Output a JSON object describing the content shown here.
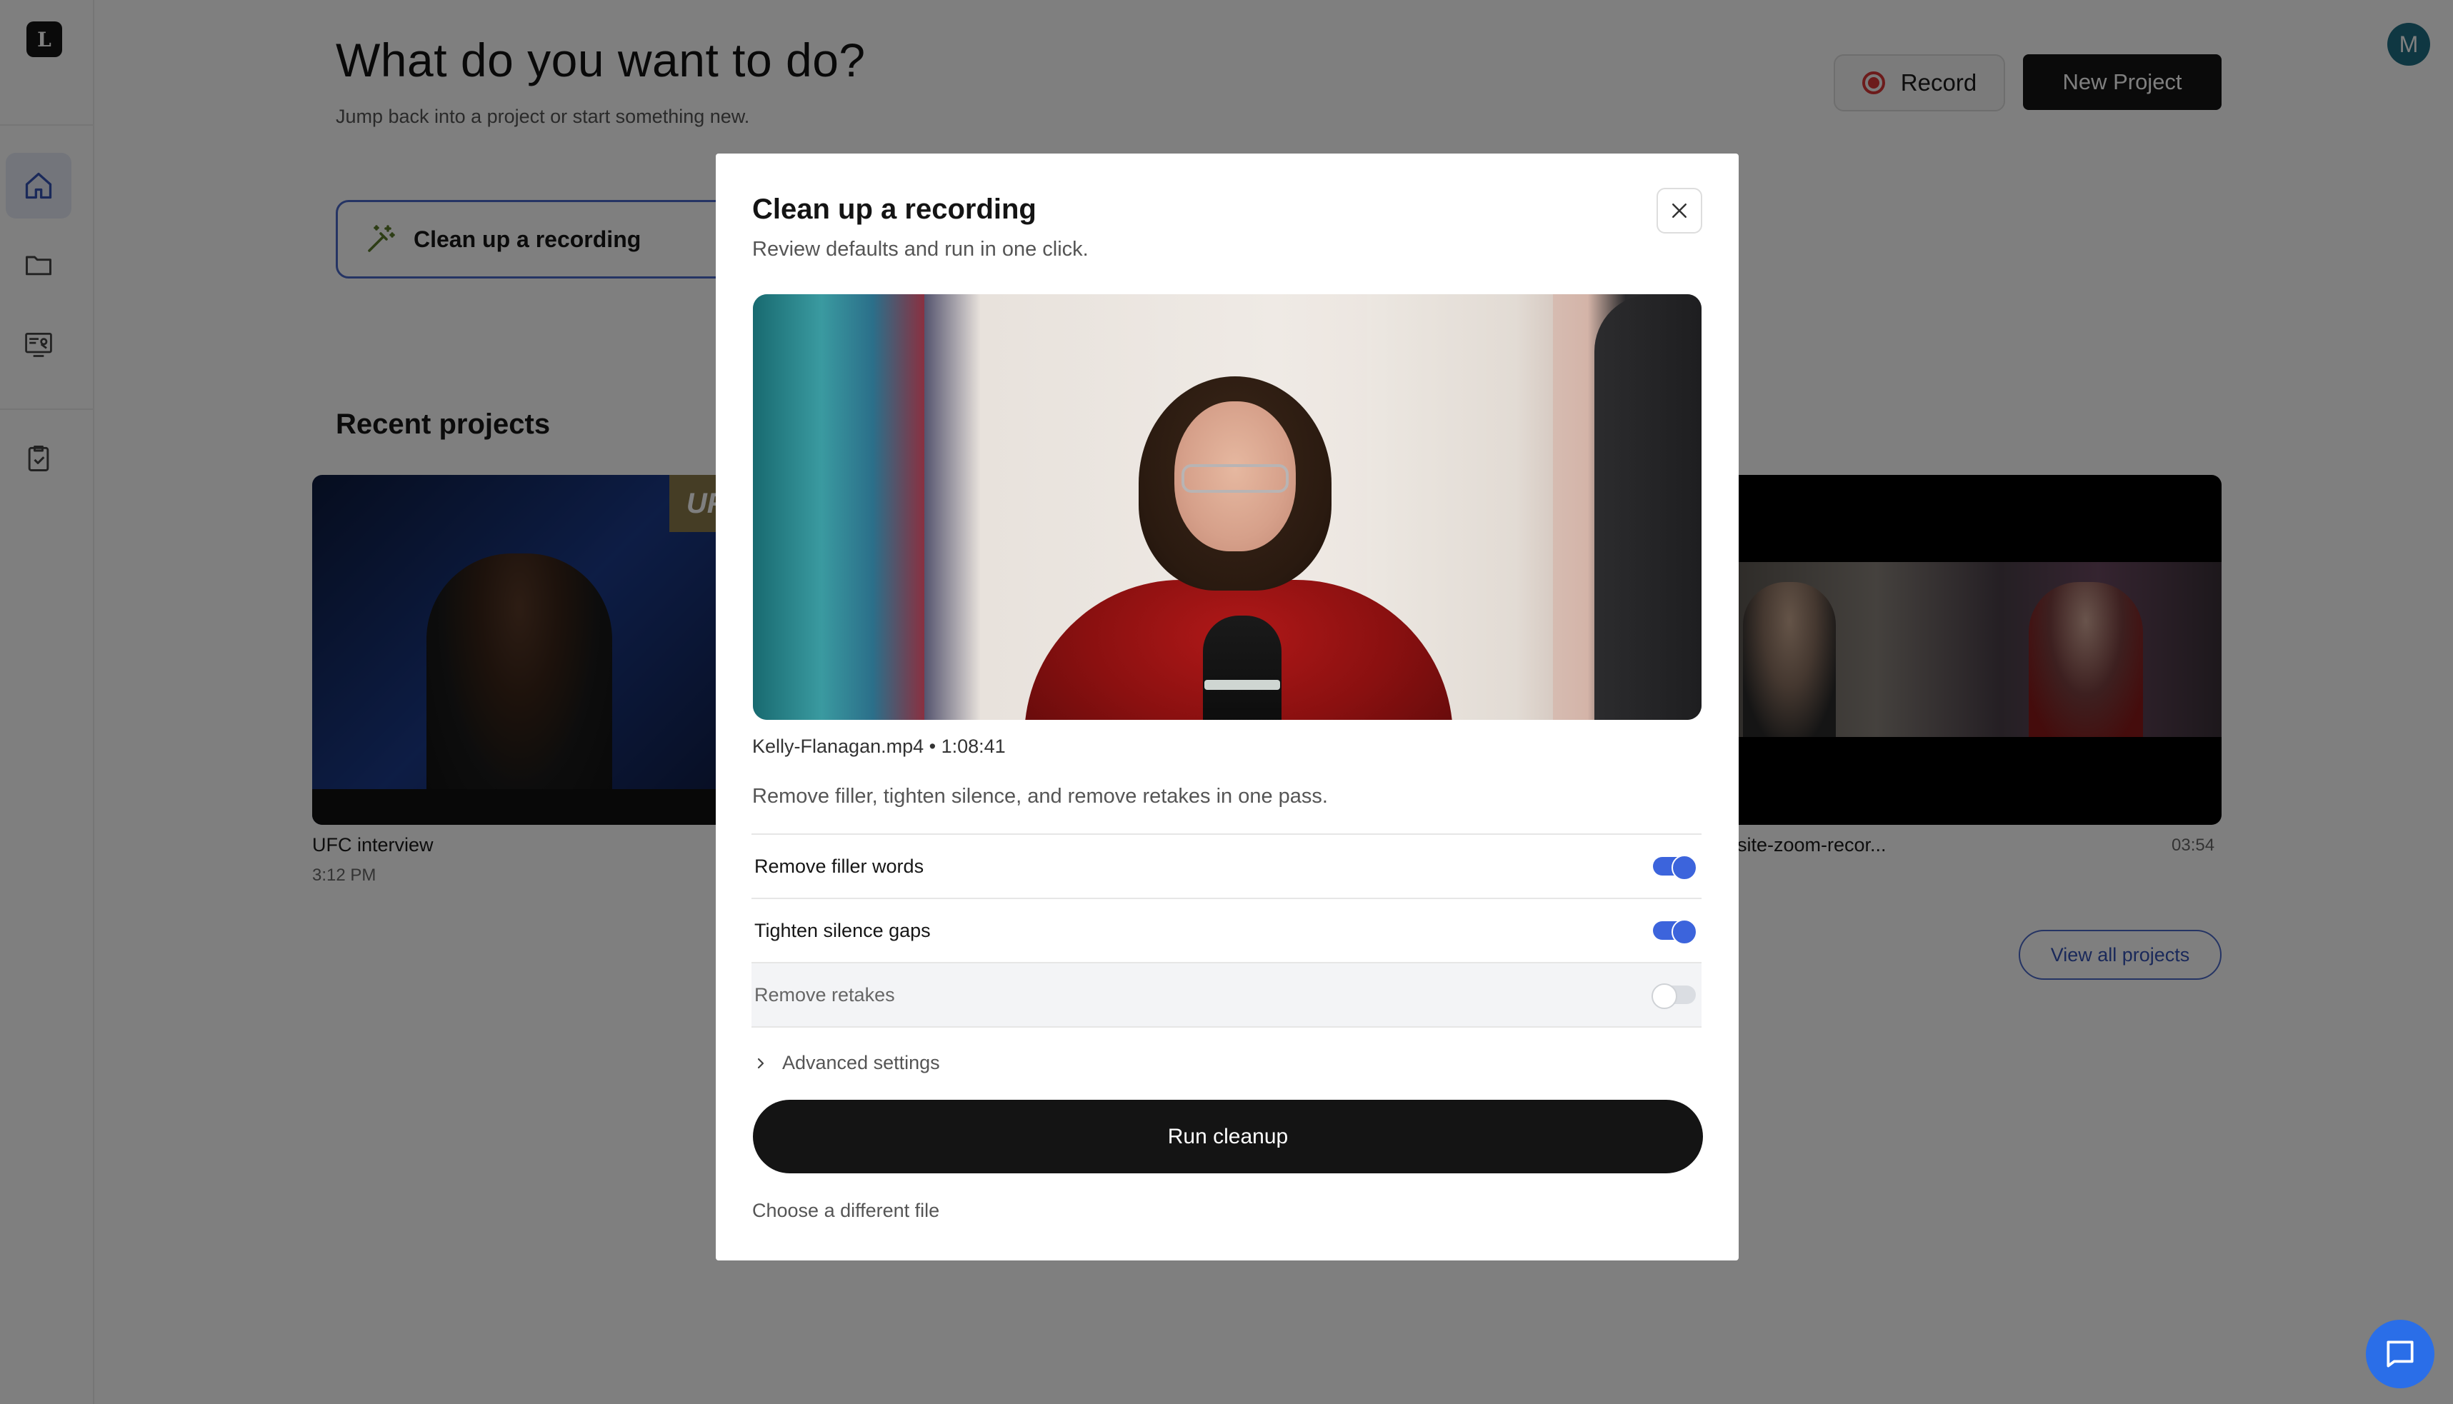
{
  "app": {
    "logo_letter": "L",
    "user_initial": "M"
  },
  "sidebar": {
    "items": [
      {
        "name": "home",
        "icon": "home-icon",
        "active": true
      },
      {
        "name": "projects",
        "icon": "folder-icon",
        "active": false
      },
      {
        "name": "demo",
        "icon": "demo-icon",
        "active": false
      },
      {
        "name": "tasks",
        "icon": "clipboard-check-icon",
        "active": false
      }
    ]
  },
  "header": {
    "title": "What do you want to do?",
    "subtitle": "Jump back into a project or start something new.",
    "record_label": "Record",
    "new_project_label": "New Project"
  },
  "actions": {
    "cleanup_label": "Clean up a recording"
  },
  "recent": {
    "title": "Recent projects",
    "projects": [
      {
        "name": "UFC interview",
        "time": "3:12 PM"
      },
      {
        "name": "site-zoom-recor...",
        "time": "03:54"
      }
    ],
    "view_all_label": "View all projects"
  },
  "modal": {
    "title": "Clean up a recording",
    "subtitle": "Review defaults and run in one click.",
    "file_meta": "Kelly-Flanagan.mp4 • 1:08:41",
    "description": "Remove filler, tighten silence, and remove retakes in one pass.",
    "options": [
      {
        "label": "Remove filler words",
        "enabled": true
      },
      {
        "label": "Tighten silence gaps",
        "enabled": true
      },
      {
        "label": "Remove retakes",
        "enabled": false
      }
    ],
    "advanced_label": "Advanced settings",
    "run_label": "Run cleanup",
    "choose_file_label": "Choose a different file"
  },
  "colors": {
    "accent": "#3c64dc",
    "primary_button": "#141414",
    "record_red": "#d93636"
  }
}
